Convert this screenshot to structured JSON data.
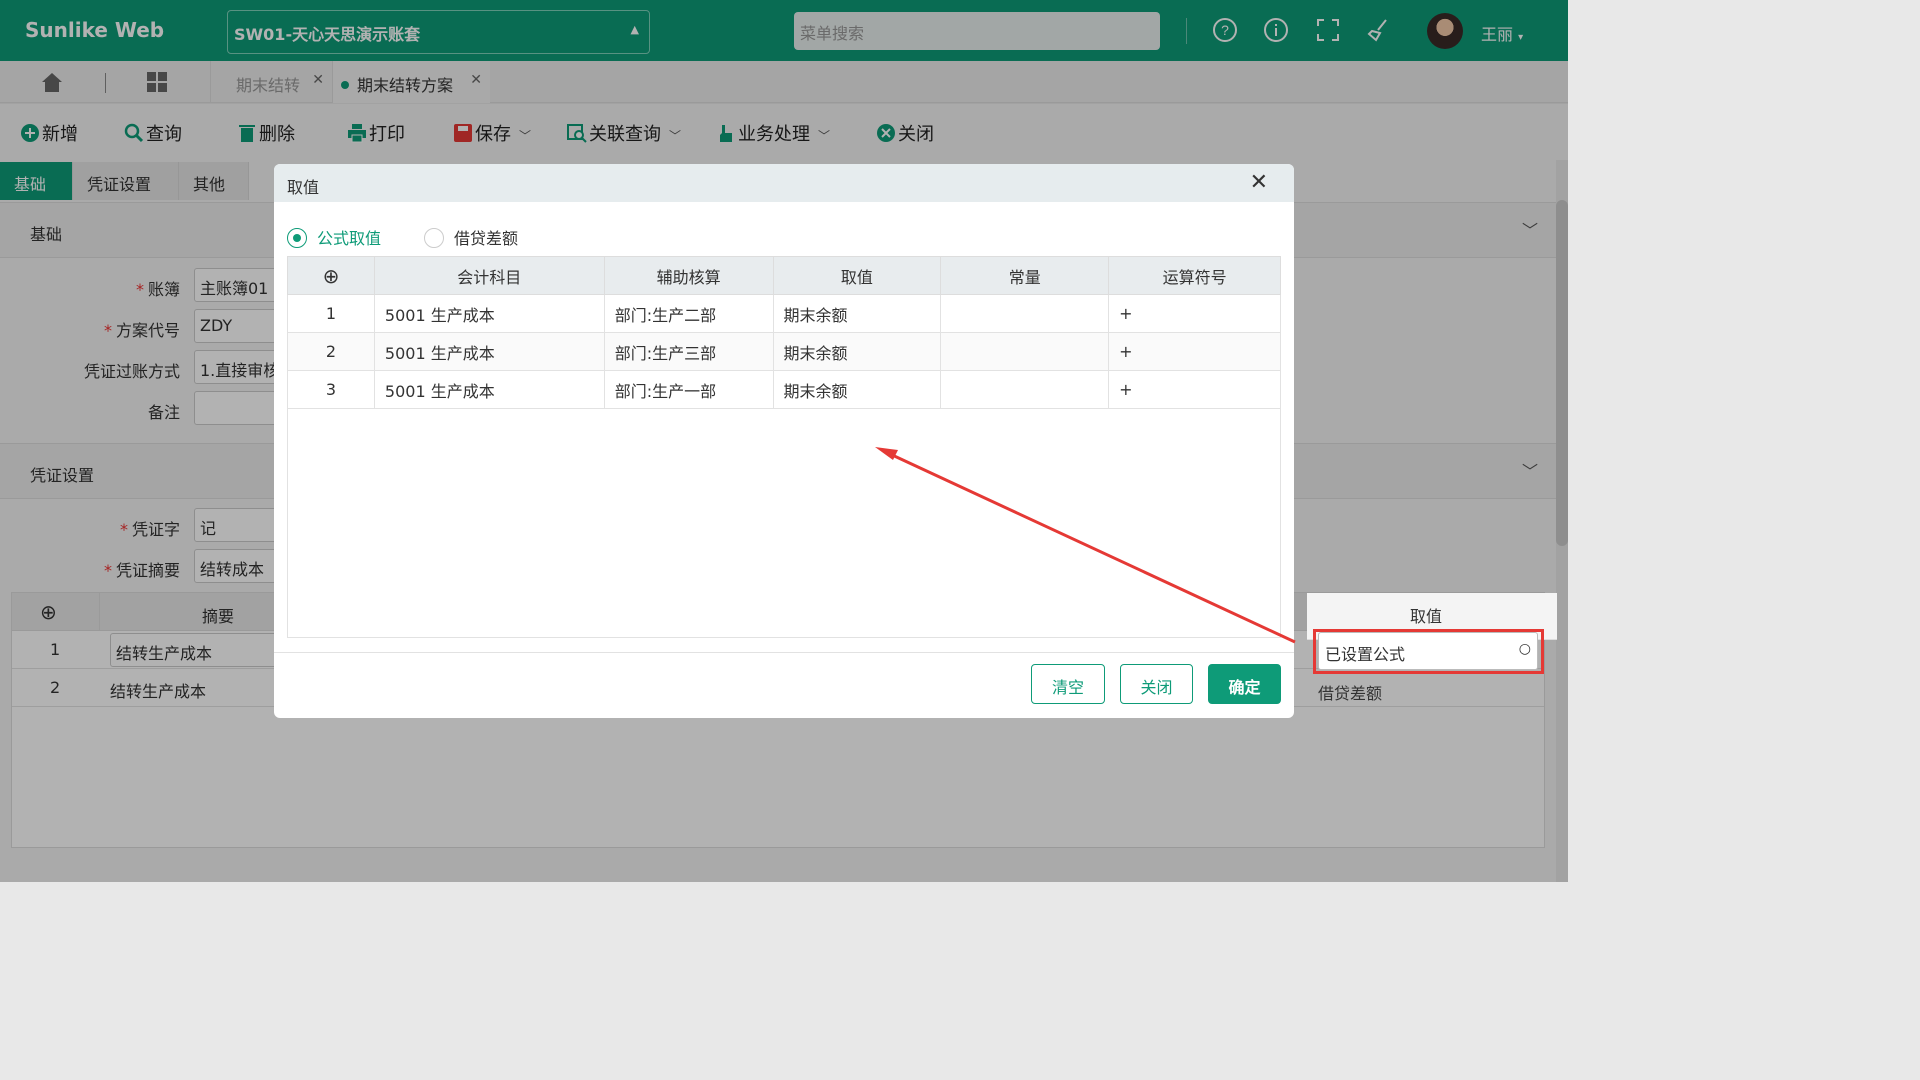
{
  "app": {
    "brand": "Sunlike Web",
    "account": "SW01-天心天思演示账套",
    "search_placeholder": "菜单搜索",
    "user": "王丽"
  },
  "page_tabs": [
    {
      "label": "期末结转"
    },
    {
      "label": "期末结转方案"
    }
  ],
  "toolbar": {
    "add": "新增",
    "query": "查询",
    "delete": "删除",
    "print": "打印",
    "save": "保存",
    "link_query": "关联查询",
    "business": "业务处理",
    "close": "关闭"
  },
  "side_tabs": [
    "基础",
    "凭证设置",
    "其他"
  ],
  "sections": {
    "basic": "基础",
    "voucher": "凭证设置"
  },
  "form": {
    "ledger_label": "账簿",
    "ledger_value": "主账簿01",
    "scheme_label": "方案代号",
    "scheme_value": "ZDY",
    "posting_label": "凭证过账方式",
    "posting_value": "1.直接审核",
    "remark_label": "备注",
    "remark_value": "",
    "vword_label": "凭证字",
    "vword_value": "记",
    "vsummary_label": "凭证摘要",
    "vsummary_value": "结转成本"
  },
  "bg_table": {
    "headers": [
      "摘要",
      "取值"
    ],
    "rows": [
      {
        "no": "1",
        "summary": "结转生产成本",
        "value": "已设置公式"
      },
      {
        "no": "2",
        "summary": "结转生产成本",
        "value": "借贷差额"
      }
    ]
  },
  "modal": {
    "title": "取值",
    "radio_formula": "公式取值",
    "radio_diff": "借贷差额",
    "headers": [
      "会计科目",
      "辅助核算",
      "取值",
      "常量",
      "运算符号"
    ],
    "rows": [
      {
        "no": "1",
        "account": "5001 生产成本",
        "aux": "部门:生产二部",
        "value": "期末余额",
        "const": "",
        "op": "+"
      },
      {
        "no": "2",
        "account": "5001 生产成本",
        "aux": "部门:生产三部",
        "value": "期末余额",
        "const": "",
        "op": "+"
      },
      {
        "no": "3",
        "account": "5001 生产成本",
        "aux": "部门:生产一部",
        "value": "期末余额",
        "const": "",
        "op": "+"
      }
    ],
    "btn_clear": "清空",
    "btn_close": "关闭",
    "btn_ok": "确定"
  },
  "colors": {
    "brand": "#0e9b78",
    "annotation": "#e53935"
  }
}
